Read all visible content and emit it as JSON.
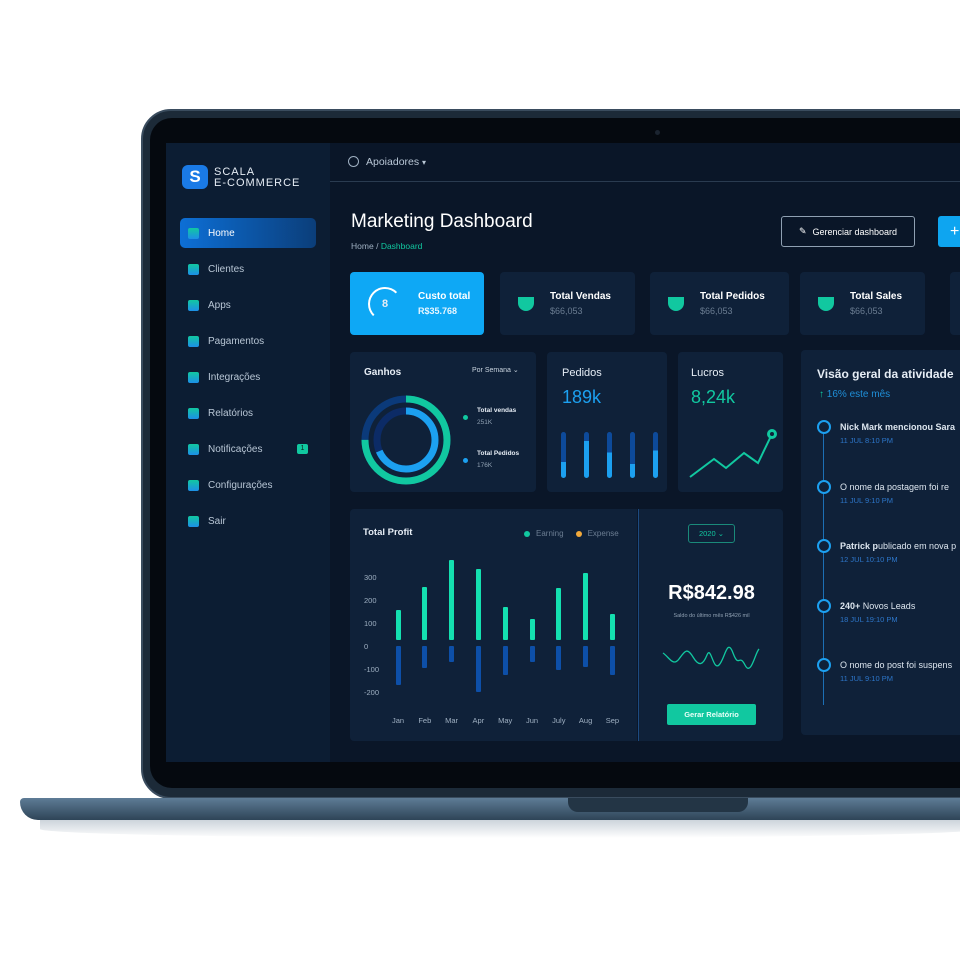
{
  "brand": {
    "line1": "SCALA",
    "line2": "E-COMMERCE"
  },
  "topbar": {
    "account": "Apoiadores"
  },
  "sidebar": {
    "items": [
      {
        "label": "Home",
        "icon": "home-icon",
        "active": true
      },
      {
        "label": "Clientes",
        "icon": "user-icon"
      },
      {
        "label": "Apps",
        "icon": "apps-icon"
      },
      {
        "label": "Pagamentos",
        "icon": "wallet-icon"
      },
      {
        "label": "Integrações",
        "icon": "integration-icon"
      },
      {
        "label": "Relatórios",
        "icon": "pie-chart-icon"
      },
      {
        "label": "Notificações",
        "icon": "bell-icon",
        "badge": "1"
      },
      {
        "label": "Configurações",
        "icon": "gear-icon"
      },
      {
        "label": "Sair",
        "icon": "logout-icon"
      }
    ]
  },
  "header": {
    "title": "Marketing Dashboard",
    "breadcrumb_home": "Home",
    "breadcrumb_sep": "/",
    "breadcrumb_current": "Dashboard",
    "manage_button": "Gerenciar dashboard",
    "add_button": "+"
  },
  "stats": [
    {
      "title": "Custo total",
      "value": "R$35.768",
      "ring_value": "8"
    },
    {
      "title": "Total Vendas",
      "value": "$66,053"
    },
    {
      "title": "Total Pedidos",
      "value": "$66,053"
    },
    {
      "title": "Total Sales",
      "value": "$66,053"
    }
  ],
  "ganhos": {
    "title": "Ganhos",
    "period": "Por Semana",
    "legend": [
      {
        "label": "Total vendas",
        "value": "251K",
        "color": "#11c8a0"
      },
      {
        "label": "Total Pedidos",
        "value": "176K",
        "color": "#1ca0f0"
      }
    ]
  },
  "pedidos": {
    "title": "Pedidos",
    "value": "189k",
    "bar_fill": [
      0.35,
      0.8,
      0.55,
      0.3,
      0.6
    ]
  },
  "lucros": {
    "title": "Lucros",
    "value": "8,24k"
  },
  "profit": {
    "title": "Total Profit",
    "legend": [
      {
        "label": "Earning",
        "color": "#11c8a0"
      },
      {
        "label": "Expense",
        "color": "#f2a93b"
      }
    ]
  },
  "chart_data": {
    "type": "bar",
    "title": "Total Profit",
    "categories": [
      "Jan",
      "Feb",
      "Mar",
      "Apr",
      "May",
      "Jun",
      "July",
      "Aug",
      "Sep"
    ],
    "series": [
      {
        "name": "Earning",
        "values": [
          130,
          230,
          350,
          310,
          145,
          90,
          225,
          290,
          115
        ]
      },
      {
        "name": "Expense",
        "values": [
          -170,
          -95,
          -70,
          -200,
          -125,
          -70,
          -105,
          -90,
          -125
        ]
      }
    ],
    "yticks": [
      "300",
      "200",
      "100",
      "0",
      "-100",
      "-200"
    ],
    "ylim": [
      -220,
      360
    ],
    "grid": false,
    "legend": "top-right"
  },
  "balance": {
    "year": "2020",
    "amount": "R$842.98",
    "subtitle": "Saldo do último mês R$426 mil",
    "button": "Gerar Relatório"
  },
  "activity": {
    "title": "Visão geral da atividade",
    "growth": "16% este mês",
    "items": [
      {
        "bold": "Nick Mark mencionou Sara",
        "text": "",
        "date": "11 JUL 8:10 PM"
      },
      {
        "bold": "",
        "text": "O nome da postagem foi re",
        "date": "11 JUL 9:10 PM"
      },
      {
        "bold": "Patrick p",
        "text": "ublicado em nova p",
        "date": "12 JUL 10:10 PM"
      },
      {
        "bold": "240+",
        "text": " Novos Leads",
        "date": "18 JUL 19:10 PM"
      },
      {
        "bold": "",
        "text": "O nome do post foi suspens",
        "date": "11 JUL 9:10 PM"
      }
    ]
  }
}
